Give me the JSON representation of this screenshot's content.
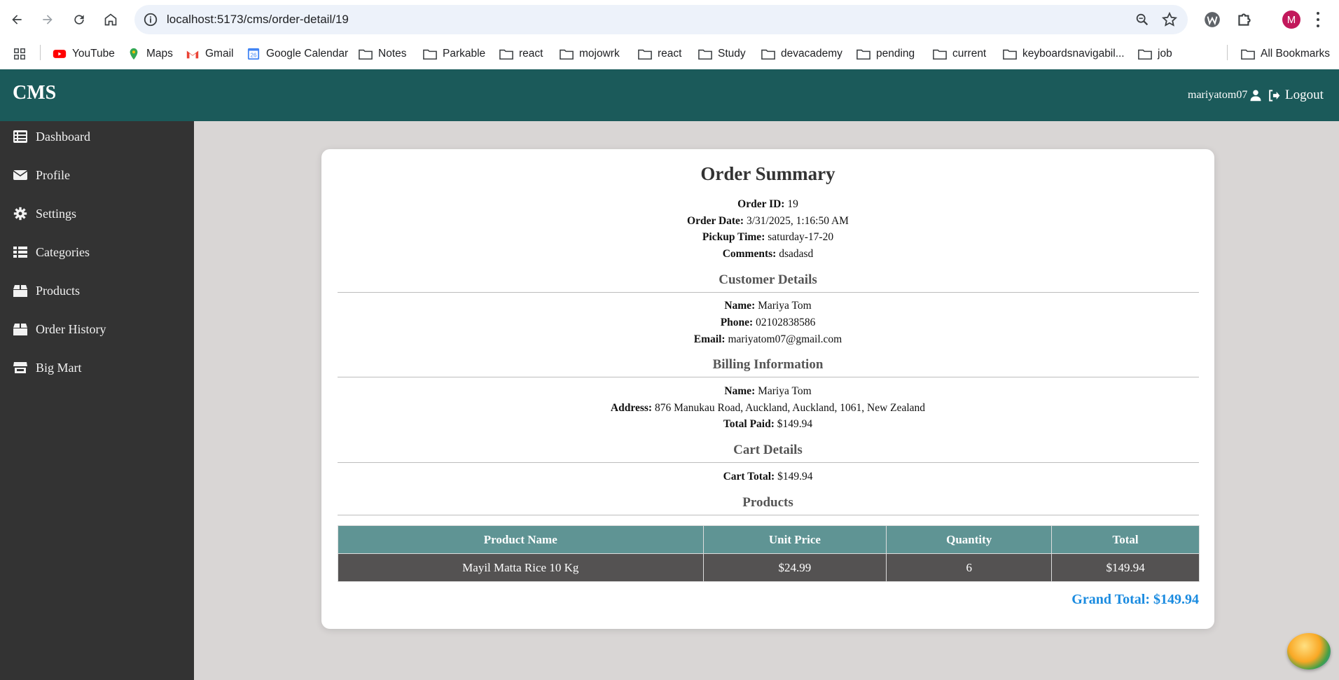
{
  "browser": {
    "url": "localhost:5173/cms/order-detail/19",
    "profile_initial": "M",
    "bookmarks": [
      "YouTube",
      "Maps",
      "Gmail",
      "Google Calendar",
      "Notes",
      "Parkable",
      "react",
      "mojowrk",
      "react",
      "Study",
      "devacademy",
      "pending",
      "current",
      "keyboardsnavigabil...",
      "job"
    ],
    "all_bookmarks": "All Bookmarks",
    "calendar_day": "26"
  },
  "header": {
    "brand": "CMS",
    "username": "mariyatom07",
    "logout_label": "Logout"
  },
  "sidebar": {
    "items": [
      {
        "label": "Dashboard",
        "icon": "list-icon"
      },
      {
        "label": "Profile",
        "icon": "envelope-icon"
      },
      {
        "label": "Settings",
        "icon": "gear-icon"
      },
      {
        "label": "Categories",
        "icon": "table-list-icon"
      },
      {
        "label": "Products",
        "icon": "box-icon"
      },
      {
        "label": "Order History",
        "icon": "box-icon"
      },
      {
        "label": "Big Mart",
        "icon": "store-icon"
      }
    ]
  },
  "order": {
    "title": "Order Summary",
    "id_label": "Order ID:",
    "id": "19",
    "date_label": "Order Date:",
    "date": "3/31/2025, 1:16:50 AM",
    "pickup_label": "Pickup Time:",
    "pickup": "saturday-17-20",
    "comments_label": "Comments:",
    "comments": "dsadasd"
  },
  "customer": {
    "heading": "Customer Details",
    "name_label": "Name:",
    "name": "Mariya Tom",
    "phone_label": "Phone:",
    "phone": "02102838586",
    "email_label": "Email:",
    "email": "mariyatom07@gmail.com"
  },
  "billing": {
    "heading": "Billing Information",
    "name_label": "Name:",
    "name": "Mariya Tom",
    "address_label": "Address:",
    "address": "876 Manukau Road, Auckland, Auckland, 1061, New Zealand",
    "paid_label": "Total Paid:",
    "paid": "$149.94"
  },
  "cart": {
    "heading": "Cart Details",
    "total_label": "Cart Total:",
    "total": "$149.94"
  },
  "products": {
    "heading": "Products",
    "columns": [
      "Product Name",
      "Unit Price",
      "Quantity",
      "Total"
    ],
    "rows": [
      [
        "Mayil Matta Rice 10 Kg",
        "$24.99",
        "6",
        "$149.94"
      ]
    ],
    "grand_total": "Grand Total: $149.94"
  },
  "colors": {
    "header": "#1b5a5a",
    "sidebar": "#333333",
    "table_header": "#5f9494",
    "table_row": "#545252",
    "grand_total": "#1a8be0"
  }
}
